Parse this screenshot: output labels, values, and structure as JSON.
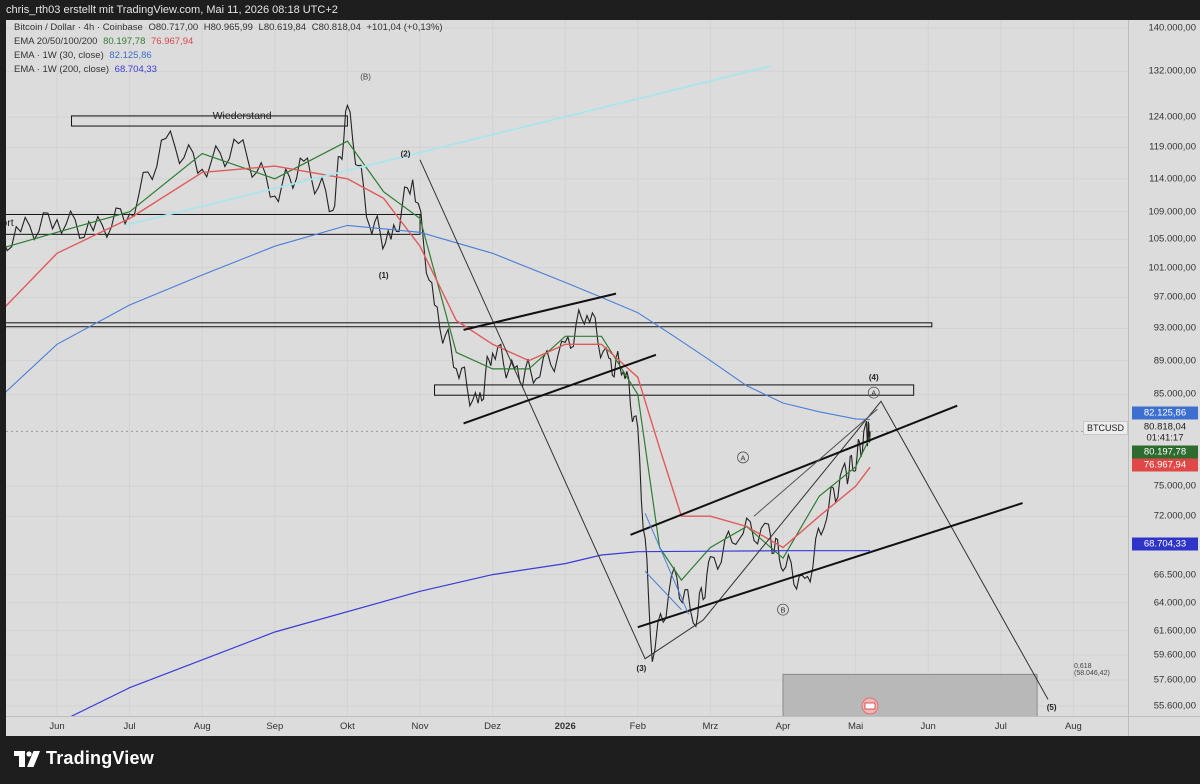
{
  "header": {
    "text": "chris_rth03 erstellt mit TradingView.com, Mai 11, 2026 08:18 UTC+2"
  },
  "legend": {
    "line1": {
      "title": "Bitcoin / Dollar · 4h · Coinbase",
      "o": "O80.717,00",
      "h": "H80.965,99",
      "l": "L80.619,84",
      "c": "C80.818,04",
      "chg": "+101,04 (+0,13%)"
    },
    "line2": {
      "title": "EMA 20/50/100/200",
      "v1": "80.197,78",
      "v2": "76.967,94"
    },
    "line3": {
      "title": "EMA · 1W (30, close)",
      "v1": "82.125,86"
    },
    "line4": {
      "title": "EMA · 1W (200, close)",
      "v1": "68.704,33"
    }
  },
  "colors": {
    "candle": "#222222",
    "ema20": "#2e7d32",
    "ema50": "#e05a5a",
    "ema1w30": "#4a7fd6",
    "ema1w200": "#3b3bd6",
    "trendline": "#a9e6ec"
  },
  "annotations": {
    "wiederstand": "Wiederstand",
    "support": "Support",
    "wave_b_top": "(B)",
    "wave_1": "(1)",
    "wave_2": "(2)",
    "wave_3": "(3)",
    "wave_4": "(4)",
    "wave_5": "(5)",
    "circle_a1": "A",
    "circle_b": "B",
    "circle_a2": "A",
    "fib": "0,618 (58.046,42)"
  },
  "price_tags": {
    "ema30w": "82.125,86",
    "symbol": "BTCUSD",
    "last": "80.818,04",
    "countdown": "01:41:17",
    "ema20": "80.197,78",
    "ema50": "76.967,94",
    "ema200w": "68.704,33"
  },
  "footer": {
    "brand": "TradingView"
  },
  "chart_data": {
    "type": "line",
    "title": "Bitcoin / Dollar · 4h · Coinbase",
    "y_ticks": [
      "140.000,00",
      "132.000,00",
      "124.000,00",
      "119.000,00",
      "114.000,00",
      "109.000,00",
      "105.000,00",
      "101.000,00",
      "97.000,00",
      "93.000,00",
      "89.000,00",
      "85.000,00",
      "75.000,00",
      "72.000,00",
      "66.500,00",
      "64.000,00",
      "61.600,00",
      "59.600,00",
      "57.600,00",
      "55.600,00"
    ],
    "y_tick_values": [
      140000,
      132000,
      124000,
      119000,
      114000,
      109000,
      105000,
      101000,
      97000,
      93000,
      89000,
      85000,
      75000,
      72000,
      66500,
      64000,
      61600,
      59600,
      57600,
      55600
    ],
    "x_ticks": [
      "Jun",
      "Jul",
      "Aug",
      "Sep",
      "Okt",
      "Nov",
      "Dez",
      "2026",
      "Feb",
      "Mrz",
      "Apr",
      "Mai",
      "Jun",
      "Jul",
      "Aug"
    ],
    "x_tick_index": [
      1.0,
      2.0,
      3.0,
      4.0,
      5.0,
      6.0,
      7.0,
      8.0,
      9.0,
      10.0,
      11.0,
      12.0,
      13.0,
      14.0,
      15.0
    ],
    "log_scale": true,
    "series": [
      {
        "name": "BTCUSD",
        "x": [
          0.0,
          0.5,
          1.0,
          1.5,
          2.0,
          2.5,
          3.0,
          3.5,
          4.0,
          4.4,
          4.8,
          5.0,
          5.3,
          5.6,
          5.9,
          6.2,
          6.5,
          6.8,
          7.0,
          7.3,
          7.6,
          8.0,
          8.3,
          8.6,
          8.8,
          9.0,
          9.2,
          9.5,
          9.8,
          10.0,
          10.4,
          10.8,
          11.0,
          11.3,
          11.6,
          11.85,
          12.0,
          12.15,
          12.2
        ],
        "y": [
          103000,
          106000,
          108000,
          106000,
          109000,
          120000,
          116000,
          119000,
          112000,
          116000,
          110000,
          125000,
          108000,
          104000,
          115000,
          95000,
          89000,
          83000,
          91000,
          87000,
          88000,
          90000,
          96000,
          88000,
          89000,
          80000,
          60000,
          66000,
          63000,
          67000,
          71000,
          70000,
          68000,
          65000,
          73000,
          76000,
          78000,
          80500,
          80818
        ]
      },
      {
        "name": "EMA 20",
        "x": [
          0.0,
          1.0,
          2.0,
          3.0,
          4.0,
          5.0,
          5.5,
          6.0,
          6.5,
          7.0,
          7.5,
          8.0,
          8.5,
          9.0,
          9.3,
          9.6,
          10.0,
          10.5,
          11.0,
          11.5,
          12.0,
          12.2
        ],
        "y": [
          103000,
          106000,
          109000,
          118000,
          114000,
          120000,
          112000,
          108000,
          90000,
          88000,
          88000,
          92000,
          92000,
          85000,
          69000,
          66000,
          69000,
          71000,
          68000,
          74000,
          77000,
          80197
        ]
      },
      {
        "name": "EMA 50",
        "x": [
          0.0,
          1.0,
          2.0,
          3.0,
          4.0,
          5.0,
          5.5,
          6.0,
          6.5,
          7.0,
          7.5,
          8.0,
          8.5,
          9.0,
          9.3,
          9.6,
          10.0,
          10.5,
          11.0,
          11.5,
          12.0,
          12.2
        ],
        "y": [
          93000,
          103000,
          108000,
          115000,
          116000,
          114000,
          111000,
          104000,
          94000,
          91000,
          89000,
          91000,
          91000,
          87000,
          79000,
          72000,
          72000,
          71000,
          69000,
          72000,
          75000,
          76967
        ]
      },
      {
        "name": "EMA 1W 30",
        "x": [
          0.0,
          1.0,
          2.0,
          3.0,
          4.0,
          5.0,
          6.0,
          7.0,
          8.0,
          8.5,
          9.0,
          9.5,
          10.0,
          10.5,
          11.0,
          11.5,
          12.0,
          12.2
        ],
        "y": [
          83000,
          91000,
          96000,
          100000,
          104000,
          107000,
          106000,
          103000,
          99000,
          97000,
          95000,
          92000,
          89000,
          86000,
          84000,
          83000,
          82200,
          82125
        ]
      },
      {
        "name": "EMA 1W 200",
        "x": [
          0.5,
          2.0,
          4.0,
          6.0,
          7.0,
          8.0,
          8.5,
          9.0,
          10.0,
          11.0,
          12.0,
          12.2
        ],
        "y": [
          53000,
          57000,
          61500,
          65000,
          66500,
          67500,
          68300,
          68600,
          68650,
          68700,
          68700,
          68704
        ]
      }
    ],
    "levels": [
      {
        "label": "Wiederstand",
        "from": 1.2,
        "to": 5.0,
        "low": 122500,
        "high": 124200
      },
      {
        "label": "Support",
        "from": 0.0,
        "to": 6.0,
        "low": 105700,
        "high": 108600
      },
      {
        "label": "",
        "from": 0.0,
        "to": 13.05,
        "low": 93200,
        "high": 93700
      },
      {
        "label": "",
        "from": 6.2,
        "to": 12.8,
        "low": 84900,
        "high": 86100
      }
    ],
    "target_zone": {
      "from": 11.0,
      "to": 14.5,
      "low": 54000,
      "high": 58046
    }
  }
}
